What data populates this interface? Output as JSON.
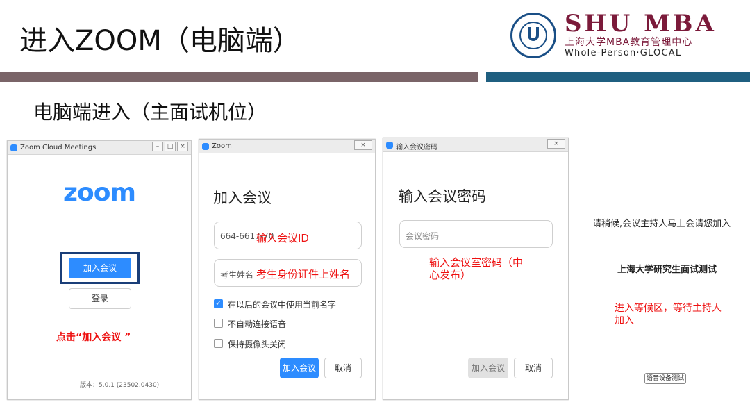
{
  "slide": {
    "title": "进入ZOOM（电脑端）",
    "subtitle": "电脑端进入（主面试机位）"
  },
  "logo": {
    "main": "SHU MBA",
    "sub": "上海大学MBA教育管理中心",
    "motto": "Whole-Person·GLOCAL"
  },
  "colors": {
    "zoom_blue": "#2d8cff",
    "annotation_red": "#ee1111",
    "divider_left": "#7a6468",
    "divider_right": "#1f5f80",
    "logo_maroon": "#7b1a3a"
  },
  "win1": {
    "title": "Zoom Cloud Meetings",
    "logo": "zoom",
    "join_button": "加入会议",
    "signin_button": "登录",
    "annotation": "点击“加入会议 ”",
    "version": "版本：5.0.1 (23502.0430)"
  },
  "win2": {
    "title": "Zoom",
    "heading": "加入会议",
    "meeting_id_value": "664-6617-70",
    "meeting_id_annotation": "输入会议ID",
    "name_value": "考生姓名",
    "name_annotation": "考生身份证件上姓名",
    "checkbox_remember": "在以后的会议中使用当前名字",
    "checkbox_remember_checked": true,
    "checkbox_audio": "不自动连接语音",
    "checkbox_video": "保持摄像头关闭",
    "join_button": "加入会议",
    "cancel_button": "取消"
  },
  "win3": {
    "title": "输入会议密码",
    "heading": "输入会议密码",
    "password_placeholder": "会议密码",
    "annotation_line1": "输入会议室密码（中",
    "annotation_line2": "心发布）",
    "join_button": "加入会议",
    "cancel_button": "取消"
  },
  "waiting": {
    "message": "请稍候,会议主持人马上会请您加入",
    "meeting_name": "上海大学研究生面试测试",
    "annotation_line1": "进入等候区，等待主持人",
    "annotation_line2": "加入",
    "audio_test_button": "语音设备测试"
  }
}
